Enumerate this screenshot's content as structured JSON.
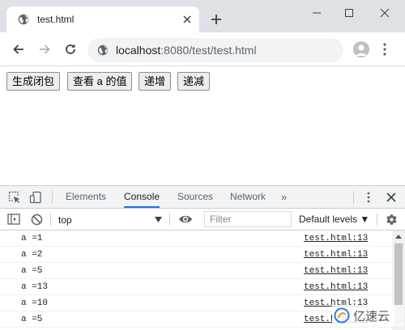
{
  "browser": {
    "tab_title": "test.html",
    "url_host": "localhost",
    "url_rest": ":8080/test/test.html"
  },
  "page": {
    "buttons": [
      {
        "label": "生成闭包"
      },
      {
        "label": "查看 a 的值"
      },
      {
        "label": "递增"
      },
      {
        "label": "递减"
      }
    ]
  },
  "devtools": {
    "tabs": [
      {
        "label": "Elements",
        "active": false
      },
      {
        "label": "Console",
        "active": true
      },
      {
        "label": "Sources",
        "active": false
      },
      {
        "label": "Network",
        "active": false
      }
    ],
    "more_label": "»",
    "context": "top",
    "filter_placeholder": "Filter",
    "levels_label": "Default levels ▼",
    "logs": [
      {
        "message": "a =1",
        "source": "test.html:13"
      },
      {
        "message": "a =2",
        "source": "test.html:13"
      },
      {
        "message": "a =5",
        "source": "test.html:13"
      },
      {
        "message": "a =13",
        "source": "test.html:13"
      },
      {
        "message": "a =10",
        "source": "test.html:13"
      },
      {
        "message": "a =5",
        "source": "test.html:13"
      }
    ],
    "accent_color": "#1a73e8"
  },
  "watermark": {
    "text": "亿速云"
  }
}
